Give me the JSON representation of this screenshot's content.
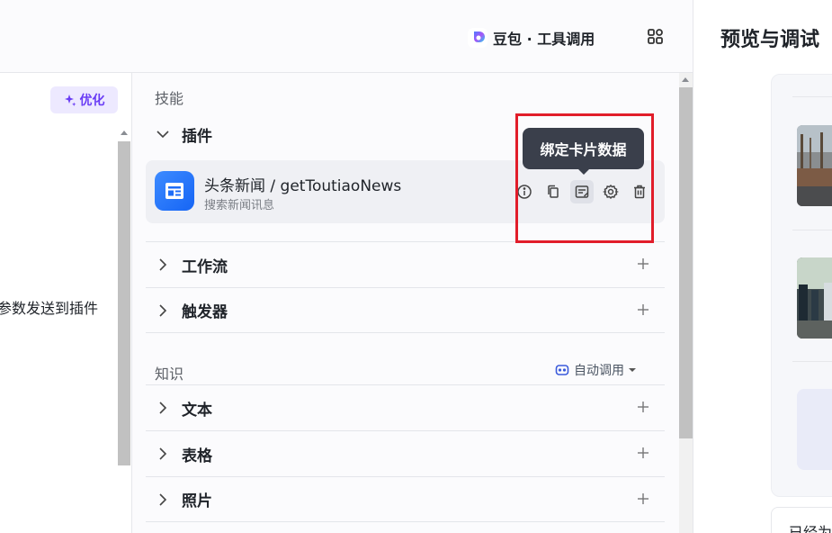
{
  "header": {
    "model_label": "豆包 · 工具调用"
  },
  "left_panel": {
    "optimize_label": "优化",
    "prompt_fragment": "参数发送到插件"
  },
  "skills": {
    "section_label": "技能",
    "plugins_label": "插件",
    "plugin": {
      "name": "头条新闻 / getToutiaoNews",
      "description": "搜索新闻讯息"
    },
    "tooltip": "绑定卡片数据",
    "workflow_label": "工作流",
    "trigger_label": "触发器"
  },
  "knowledge": {
    "section_label": "知识",
    "auto_call_label": "自动调用",
    "items": [
      {
        "label": "文本"
      },
      {
        "label": "表格"
      },
      {
        "label": "照片"
      }
    ]
  },
  "preview": {
    "title": "预览与调试",
    "bottom_text": "已经为"
  },
  "colors": {
    "accent_purple": "#6a3df5",
    "highlight_red": "#e11d2a",
    "tooltip_bg": "#3a3f4b"
  }
}
